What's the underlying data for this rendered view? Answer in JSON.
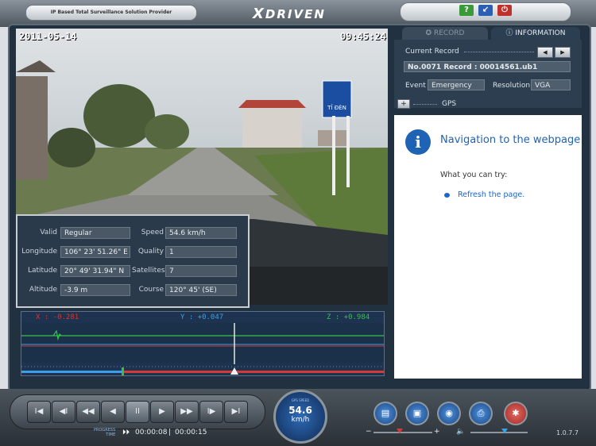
{
  "app": {
    "tagline": "IP Based Total Surveillance Solution Provider",
    "logo": "DRIVEN",
    "logo_mark": "X"
  },
  "title_buttons": {
    "help": "?",
    "minimize": "↙",
    "power": "⏻"
  },
  "video": {
    "date": "2011-05-14",
    "time": "09:45:24",
    "sign_text": "TỈ ĐÈN"
  },
  "gps": {
    "valid_label": "Valid",
    "valid_value": "Regular",
    "speed_label": "Speed",
    "speed_value": "54.6 km/h",
    "longitude_label": "Longitude",
    "longitude_value": "106° 23' 51.26\" E",
    "quality_label": "Quality",
    "quality_value": "1",
    "latitude_label": "Latitude",
    "latitude_value": "20° 49' 31.94\" N",
    "satellites_label": "Satellites",
    "satellites_value": "7",
    "altitude_label": "Altitude",
    "altitude_value": "-3.9 m",
    "course_label": "Course",
    "course_value": "120° 45' (SE)"
  },
  "sensor": {
    "x_label": "X : -0.281",
    "y_label": "Y : +0.047",
    "z_label": "Z : +0.984",
    "x_color": "#e0332e",
    "y_color": "#3aa0e8",
    "z_color": "#36c24a"
  },
  "tabs": {
    "record": "RECORD",
    "information": "INFORMATION"
  },
  "info": {
    "current_record_label": "Current Record",
    "prev": "◀",
    "next": "▶",
    "record_value": "No.0071 Record : 00014561.ub1",
    "event_label": "Event",
    "event_value": "Emergency",
    "resolution_label": "Resolution",
    "resolution_value": "VGA",
    "gps_toggle": "+",
    "gps_section": "GPS"
  },
  "webview": {
    "heading": "Navigation to the webpage was canceled",
    "try_label": "What you can try:",
    "refresh_link": "Refresh the page."
  },
  "controls": {
    "buttons": [
      "I◀",
      "◀I",
      "◀◀",
      "◀",
      "II",
      "▶",
      "▶▶",
      "I▶",
      "▶I"
    ],
    "progress_label": "PROGRESS",
    "time_label": "TIME",
    "elapsed": "00:00:08",
    "total": "00:00:15",
    "speed_unit_top": "GPS SPEED",
    "speed_value": "54.6",
    "speed_unit": "km/h",
    "version": "1.0.7.7",
    "zoom_minus": "−",
    "zoom_plus": "+",
    "volume_icon": "🔈"
  },
  "progress": {
    "position_fraction": 0.53,
    "zoom_fraction": 0.45,
    "volume_fraction": 0.6
  },
  "colors": {
    "accent_blue": "#1f63b5",
    "tab_active": "#2c3e51",
    "link_blue": "#1a66c9"
  }
}
